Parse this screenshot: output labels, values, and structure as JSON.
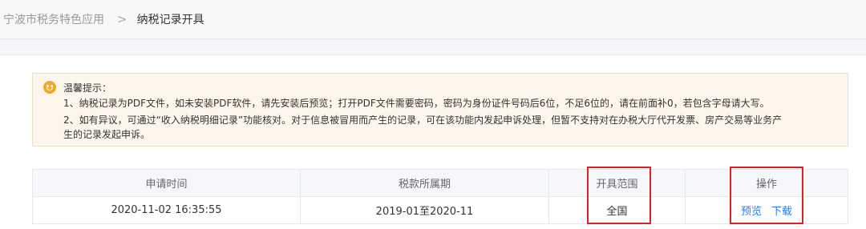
{
  "breadcrumb": {
    "parent": "宁波市税务特色应用",
    "separator": ">",
    "current": "纳税记录开具"
  },
  "notice": {
    "icon": "smiley-icon",
    "title": "温馨提示：",
    "line1": "1、纳税记录为PDF文件，如未安装PDF软件，请先安装后预览；打开PDF文件需要密码，密码为身份证件号码后6位，不足6位的，请在前面补0，若包含字母请大写。",
    "line2": "2、如有异议，可通过“收入纳税明细记录”功能核对。对于信息被冒用而产生的记录，可在该功能内发起申诉处理，但暂不支持对在办税大厅代开发票、房产交易等业务产",
    "line3": "生的记录发起申诉。"
  },
  "table": {
    "headers": [
      "申请时间",
      "税款所属期",
      "开具范围",
      "操作"
    ],
    "rows": [
      {
        "apply_time": "2020-11-02 16:35:55",
        "tax_period": "2019-01至2020-11",
        "scope": "全国",
        "actions": {
          "preview": "预览",
          "download": "下载"
        }
      }
    ]
  },
  "colors": {
    "link": "#2d7de0",
    "notice_bg": "#fdf6ec",
    "notice_icon": "#f5a623",
    "highlight": "#e02020"
  }
}
